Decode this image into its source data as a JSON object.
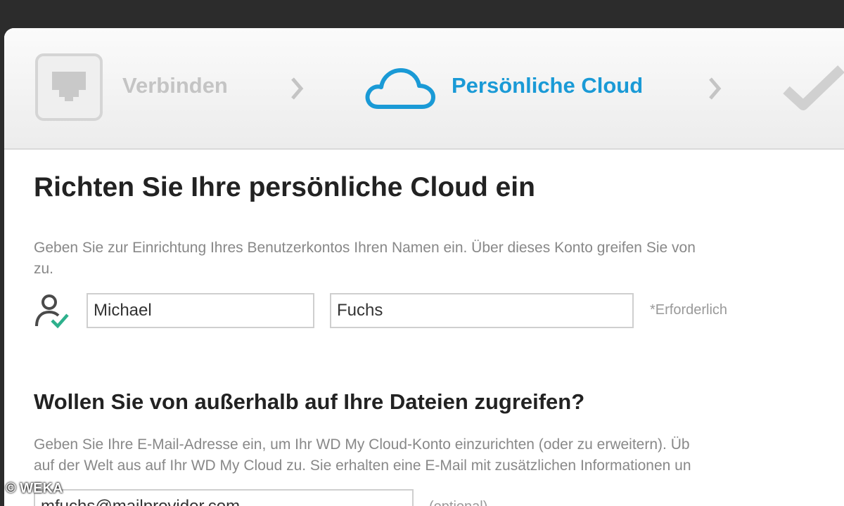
{
  "wizard": {
    "steps": [
      {
        "label": "Verbinden",
        "icon": "network-port-icon",
        "state": "done"
      },
      {
        "label": "Persönliche Cloud",
        "icon": "cloud-icon",
        "state": "active"
      },
      {
        "label": "",
        "icon": "checkmark-icon",
        "state": "pending"
      }
    ],
    "active_color": "#1a9ad6",
    "inactive_color": "#c4c4c4"
  },
  "section1": {
    "title": "Richten Sie Ihre persönliche Cloud ein",
    "description_line1": "Geben Sie zur Einrichtung Ihres Benutzerkontos Ihren Namen ein. Über dieses Konto greifen Sie von",
    "description_line2": "zu.",
    "first_name_value": "Michael",
    "last_name_value": "Fuchs",
    "required_note": "*Erforderlich",
    "user_icon": "user-check-icon"
  },
  "section2": {
    "title": "Wollen Sie von außerhalb auf Ihre Dateien zugreifen?",
    "description_line1": "Geben Sie Ihre E-Mail-Adresse ein, um Ihr WD My Cloud-Konto einzurichten (oder zu erweitern). Üb",
    "description_line2": "auf der Welt aus auf Ihr WD My Cloud zu. Sie erhalten eine E-Mail mit zusätzlichen Informationen un",
    "email_value": "mfuchs@mailprovider.com",
    "optional_note": "(optional)"
  },
  "copyright": "© WEKA"
}
